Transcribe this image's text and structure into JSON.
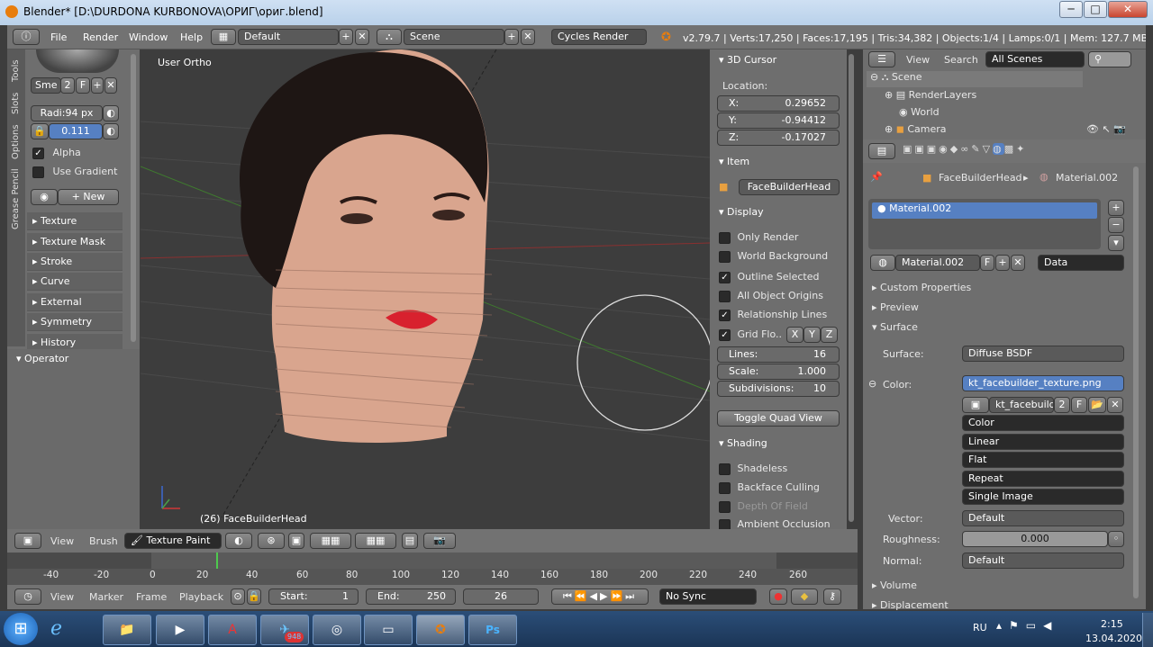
{
  "window": {
    "title": "Blender* [D:\\DURDONA KURBONOVA\\ОРИГ\\ориг.blend]",
    "min": "─",
    "max": "□",
    "close": "✕"
  },
  "menu": {
    "file": "File",
    "render": "Render",
    "window": "Window",
    "help": "Help",
    "layout": "Default",
    "scene": "Scene",
    "engine": "Cycles Render",
    "stats": "v2.79.7 | Verts:17,250 | Faces:17,195 | Tris:34,382 | Objects:1/4 | Lamps:0/1 | Mem: 127.7 MB | FaceBuilder"
  },
  "tools": {
    "tabs": [
      "Tools",
      "Slots",
      "Options",
      "Grease Pencil"
    ],
    "brush_name": "Sme",
    "brush_users": "2",
    "brush_f": "F",
    "radius": "Radi:94 px",
    "strength": "0.111",
    "alpha": "Alpha",
    "use_gradient": "Use Gradient",
    "new": "New",
    "sections": [
      "Texture",
      "Texture Mask",
      "Stroke",
      "Curve",
      "External",
      "Symmetry",
      "History"
    ],
    "operator": "Operator"
  },
  "viewport": {
    "view_label": "User Ortho",
    "object_label": "(26) FaceBuilderHead"
  },
  "npanel": {
    "cursor_title": "3D Cursor",
    "location": "Location:",
    "x_label": "X:",
    "x": "0.29652",
    "y_label": "Y:",
    "y": "-0.94412",
    "z_label": "Z:",
    "z": "-0.17027",
    "item_title": "Item",
    "item_name": "FaceBuilderHead",
    "display_title": "Display",
    "only_render": "Only Render",
    "world_bg": "World Background",
    "outline_sel": "Outline Selected",
    "all_origins": "All Object Origins",
    "rel_lines": "Relationship Lines",
    "grid_floor": "Grid Flo..",
    "gx": "X",
    "gy": "Y",
    "gz": "Z",
    "lines_label": "Lines:",
    "lines": "16",
    "scale_label": "Scale:",
    "scale": "1.000",
    "subdiv_label": "Subdivisions:",
    "subdiv": "10",
    "toggle_quad": "Toggle Quad View",
    "shading_title": "Shading",
    "shadeless": "Shadeless",
    "backface": "Backface Culling",
    "depth_field": "Depth Of Field",
    "ambient": "Ambient Occlusion"
  },
  "outliner": {
    "view": "View",
    "search": "Search",
    "scenes": "All Scenes",
    "items": [
      "Scene",
      "RenderLayers",
      "World",
      "Camera"
    ]
  },
  "properties": {
    "crumb_obj": "FaceBuilderHead",
    "crumb_mat": "Material.002",
    "slot": "Material.002",
    "mat_field": "Material.002",
    "mat_f": "F",
    "link": "Data",
    "custom": "Custom Properties",
    "preview": "Preview",
    "surface_title": "Surface",
    "surface_label": "Surface:",
    "surface": "Diffuse BSDF",
    "color_label": "Color:",
    "color_tex": "kt_facebuilder_texture.png",
    "img_name": "kt_facebuild...",
    "img_users": "2",
    "img_f": "F",
    "opts": [
      "Color",
      "Linear",
      "Flat",
      "Repeat",
      "Single Image"
    ],
    "vector_label": "Vector:",
    "vector": "Default",
    "rough_label": "Roughness:",
    "rough": "0.000",
    "normal_label": "Normal:",
    "normal": "Default",
    "volume": "Volume",
    "displacement": "Displacement"
  },
  "viewbar": {
    "view": "View",
    "brush": "Brush",
    "mode": "Texture Paint"
  },
  "timeline": {
    "ticks": [
      "-40",
      "-20",
      "0",
      "20",
      "40",
      "60",
      "80",
      "100",
      "120",
      "140",
      "160",
      "180",
      "200",
      "220",
      "240",
      "260"
    ]
  },
  "tlbar": {
    "view": "View",
    "marker": "Marker",
    "frame": "Frame",
    "playback": "Playback",
    "start": "Start:",
    "start_v": "1",
    "end": "End:",
    "end_v": "250",
    "current": "26",
    "sync": "No Sync"
  },
  "taskbar": {
    "lang": "RU",
    "time": "2:15",
    "date": "13.04.2020",
    "badge": "948"
  },
  "colors": {
    "accent": "#5680c2",
    "bg": "#3d3d3d",
    "panel": "#6e6e6e"
  }
}
